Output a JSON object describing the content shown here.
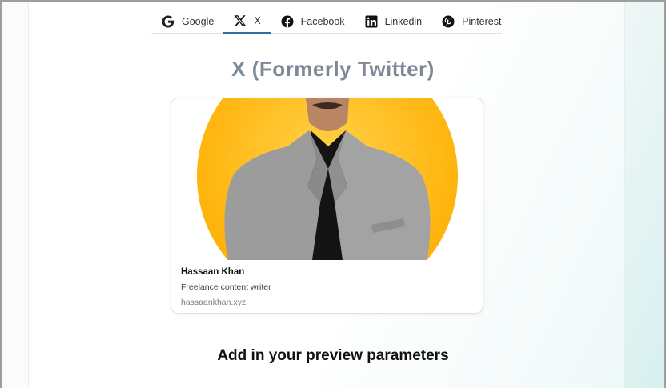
{
  "tabs": [
    {
      "label": "Google",
      "icon": "google-icon"
    },
    {
      "label": "X",
      "icon": "x-icon"
    },
    {
      "label": "Facebook",
      "icon": "facebook-icon"
    },
    {
      "label": "Linkedin",
      "icon": "linkedin-icon"
    },
    {
      "label": "Pinterest",
      "icon": "pinterest-icon"
    }
  ],
  "active_tab": "X",
  "page_title": "X (Formerly Twitter)",
  "preview_card": {
    "name": "Hassaan Khan",
    "description": "Freelance content writer",
    "url": "hassaankhan.xyz"
  },
  "section_heading": "Add in your preview parameters",
  "colors": {
    "accent": "#2f6fa8",
    "title": "#7e8896",
    "avatar_bg": "#ffb300"
  }
}
